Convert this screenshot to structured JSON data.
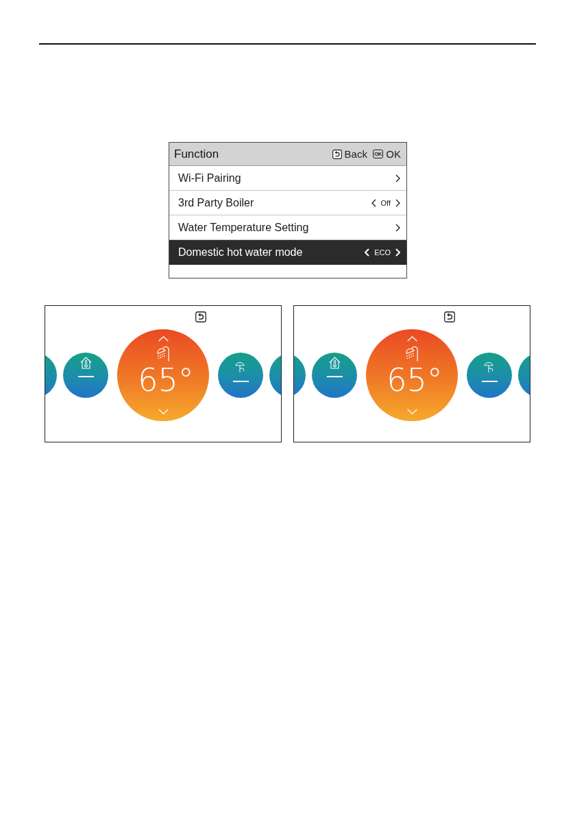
{
  "menu": {
    "title": "Function",
    "keys": [
      {
        "kind": "back",
        "label": "Back"
      },
      {
        "kind": "ok",
        "key": "OK",
        "label": "OK"
      }
    ],
    "rows": [
      {
        "kind": "link",
        "label": "Wi-Fi Pairing",
        "selected": false
      },
      {
        "kind": "option",
        "label": "3rd Party Boiler",
        "value": "Off",
        "selected": false
      },
      {
        "kind": "link",
        "label": "Water Temperature Setting",
        "selected": false
      },
      {
        "kind": "option",
        "label": "Domestic hot water mode",
        "value": "ECO",
        "selected": true
      }
    ]
  },
  "panels": [
    {
      "modes": [
        {
          "kind": "edge"
        },
        {
          "kind": "room"
        },
        {
          "kind": "hot_water",
          "value": "65°"
        },
        {
          "kind": "umbrella"
        },
        {
          "kind": "edge"
        }
      ]
    },
    {
      "modes": [
        {
          "kind": "edge"
        },
        {
          "kind": "room"
        },
        {
          "kind": "hot_water",
          "value": "65°"
        },
        {
          "kind": "umbrella"
        },
        {
          "kind": "edge"
        }
      ]
    }
  ]
}
